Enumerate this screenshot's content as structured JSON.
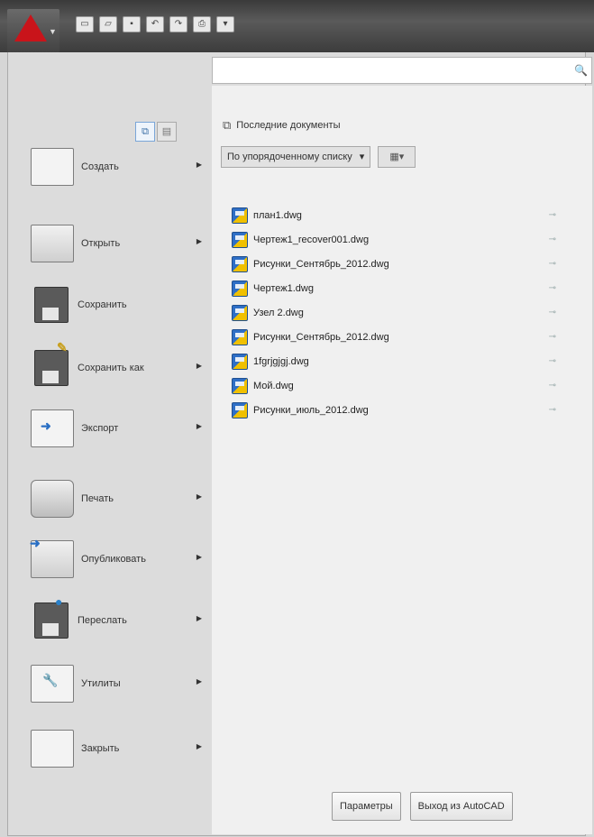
{
  "quick_access": {
    "icons": [
      "new-file-icon",
      "open-file-icon",
      "save-icon",
      "undo-icon",
      "redo-icon",
      "plot-icon",
      "more-icon"
    ]
  },
  "search": {
    "placeholder": ""
  },
  "commands": [
    {
      "label": "Создать",
      "icon": "new-doc-icon",
      "has_submenu": true
    },
    {
      "label": "Открыть",
      "icon": "open-folder-icon",
      "has_submenu": true
    },
    {
      "label": "Сохранить",
      "icon": "save-disk-icon",
      "has_submenu": false
    },
    {
      "label": "Сохранить как",
      "icon": "save-as-icon",
      "has_submenu": true
    },
    {
      "label": "Экспорт",
      "icon": "export-icon",
      "has_submenu": true
    },
    {
      "label": "Печать",
      "icon": "printer-icon",
      "has_submenu": true
    },
    {
      "label": "Опубликовать",
      "icon": "publish-icon",
      "has_submenu": true
    },
    {
      "label": "Переслать",
      "icon": "send-icon",
      "has_submenu": true
    },
    {
      "label": "Утилиты",
      "icon": "utilities-icon",
      "has_submenu": true
    },
    {
      "label": "Закрыть",
      "icon": "close-doc-icon",
      "has_submenu": true
    }
  ],
  "recent": {
    "title": "Последние документы",
    "sort_label": "По упорядоченному списку",
    "files": [
      "план1.dwg",
      "Чертеж1_recover001.dwg",
      "Рисунки_Сентябрь_2012.dwg",
      "Чертеж1.dwg",
      "Узел 2.dwg",
      "Рисунки_Сентябрь_2012.dwg",
      "1fgrjgjgj.dwg",
      "Мой.dwg",
      "Рисунки_июль_2012.dwg"
    ]
  },
  "buttons": {
    "options": "Параметры",
    "exit": "Выход из AutoCAD"
  }
}
